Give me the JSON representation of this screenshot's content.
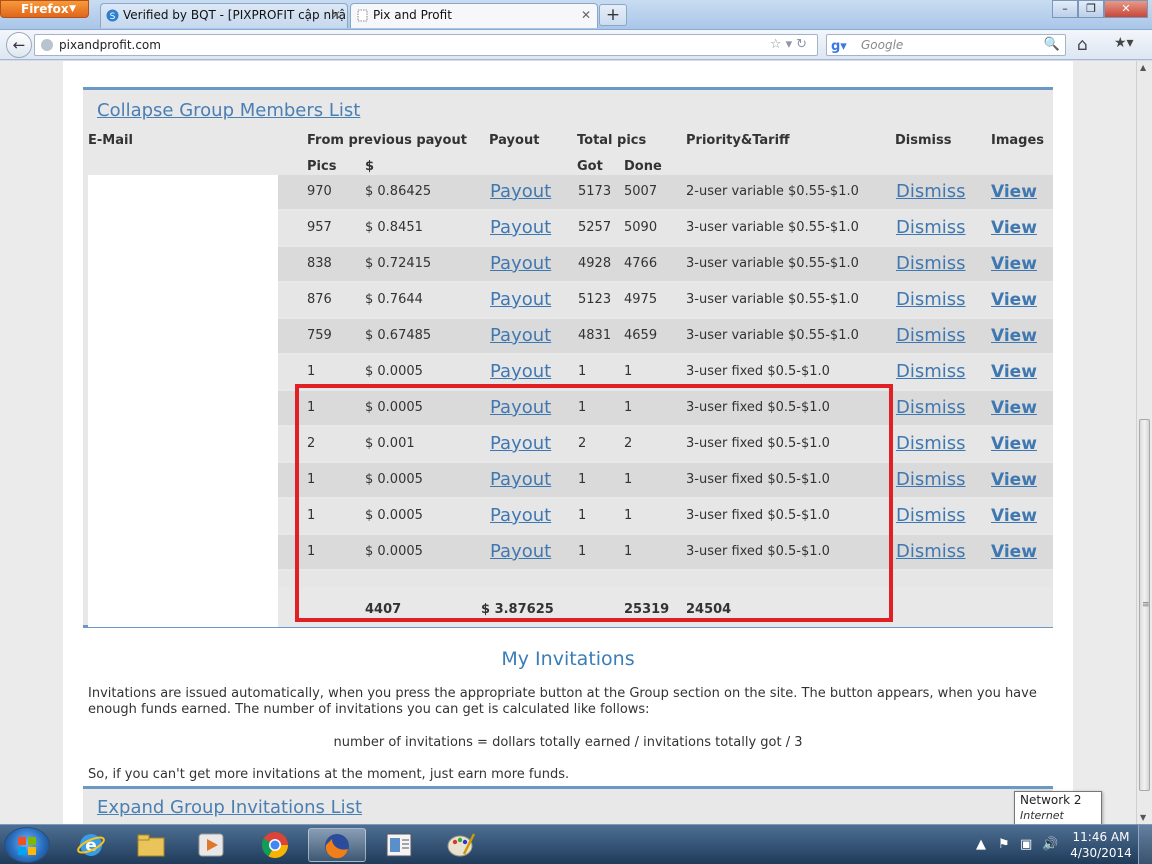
{
  "browser": {
    "app_button": "Firefox",
    "tabs": [
      {
        "label": "Verified by BQT - [PIXPROFIT cập nhậ..."
      },
      {
        "label": "Pix and Profit"
      }
    ],
    "url": "pixandprofit.com",
    "search_placeholder": "Google"
  },
  "group_members": {
    "collapse_link": "Collapse Group Members List",
    "headers": {
      "email": "E-Mail",
      "from_previous_payout": "From previous payout",
      "payout": "Payout",
      "total_pics": "Total pics",
      "priority": "Priority&Tariff",
      "dismiss": "Dismiss",
      "images": "Images",
      "pics": "Pics",
      "usd": "$",
      "got": "Got",
      "done": "Done"
    },
    "rows": [
      {
        "pics": "970",
        "usd": "$ 0.86425",
        "payout": "Payout",
        "got": "5173",
        "done": "5007",
        "priority": "2-user variable $0.55-$1.0",
        "dismiss": "Dismiss",
        "view": "View"
      },
      {
        "pics": "957",
        "usd": "$ 0.8451",
        "payout": "Payout",
        "got": "5257",
        "done": "5090",
        "priority": "3-user variable $0.55-$1.0",
        "dismiss": "Dismiss",
        "view": "View"
      },
      {
        "pics": "838",
        "usd": "$ 0.72415",
        "payout": "Payout",
        "got": "4928",
        "done": "4766",
        "priority": "3-user variable $0.55-$1.0",
        "dismiss": "Dismiss",
        "view": "View"
      },
      {
        "pics": "876",
        "usd": "$ 0.7644",
        "payout": "Payout",
        "got": "5123",
        "done": "4975",
        "priority": "3-user variable $0.55-$1.0",
        "dismiss": "Dismiss",
        "view": "View"
      },
      {
        "pics": "759",
        "usd": "$ 0.67485",
        "payout": "Payout",
        "got": "4831",
        "done": "4659",
        "priority": "3-user variable $0.55-$1.0",
        "dismiss": "Dismiss",
        "view": "View"
      },
      {
        "pics": "1",
        "usd": "$ 0.0005",
        "payout": "Payout",
        "got": "1",
        "done": "1",
        "priority": "3-user fixed $0.5-$1.0",
        "dismiss": "Dismiss",
        "view": "View"
      },
      {
        "pics": "1",
        "usd": "$ 0.0005",
        "payout": "Payout",
        "got": "1",
        "done": "1",
        "priority": "3-user fixed $0.5-$1.0",
        "dismiss": "Dismiss",
        "view": "View"
      },
      {
        "pics": "2",
        "usd": "$ 0.001",
        "payout": "Payout",
        "got": "2",
        "done": "2",
        "priority": "3-user fixed $0.5-$1.0",
        "dismiss": "Dismiss",
        "view": "View"
      },
      {
        "pics": "1",
        "usd": "$ 0.0005",
        "payout": "Payout",
        "got": "1",
        "done": "1",
        "priority": "3-user fixed $0.5-$1.0",
        "dismiss": "Dismiss",
        "view": "View"
      },
      {
        "pics": "1",
        "usd": "$ 0.0005",
        "payout": "Payout",
        "got": "1",
        "done": "1",
        "priority": "3-user fixed $0.5-$1.0",
        "dismiss": "Dismiss",
        "view": "View"
      },
      {
        "pics": "1",
        "usd": "$ 0.0005",
        "payout": "Payout",
        "got": "1",
        "done": "1",
        "priority": "3-user fixed $0.5-$1.0",
        "dismiss": "Dismiss",
        "view": "View"
      }
    ],
    "totals": {
      "pics": "4407",
      "payout": "$ 3.87625",
      "done": "25319",
      "priority": "24504"
    }
  },
  "invitations": {
    "title": "My Invitations",
    "paragraph": "Invitations are issued automatically, when you press the appropriate button at the Group section on the site. The button appears, when you have enough funds earned. The number of invitations you can get is calculated like follows:",
    "formula": "number of invitations = dollars totally earned / invitations totally got / 3",
    "paragraph2": "So, if you can't get more invitations at the moment, just earn more funds.",
    "expand_link": "Expand Group Invitations List"
  },
  "tooltip": {
    "line1": "Network  2",
    "line2": "Internet access"
  },
  "taskbar": {
    "time": "11:46 AM",
    "date": "4/30/2014"
  },
  "colors": {
    "link": "#3f78b1",
    "highlight_box": "#e02025",
    "panel_border": "#6b98c4"
  }
}
